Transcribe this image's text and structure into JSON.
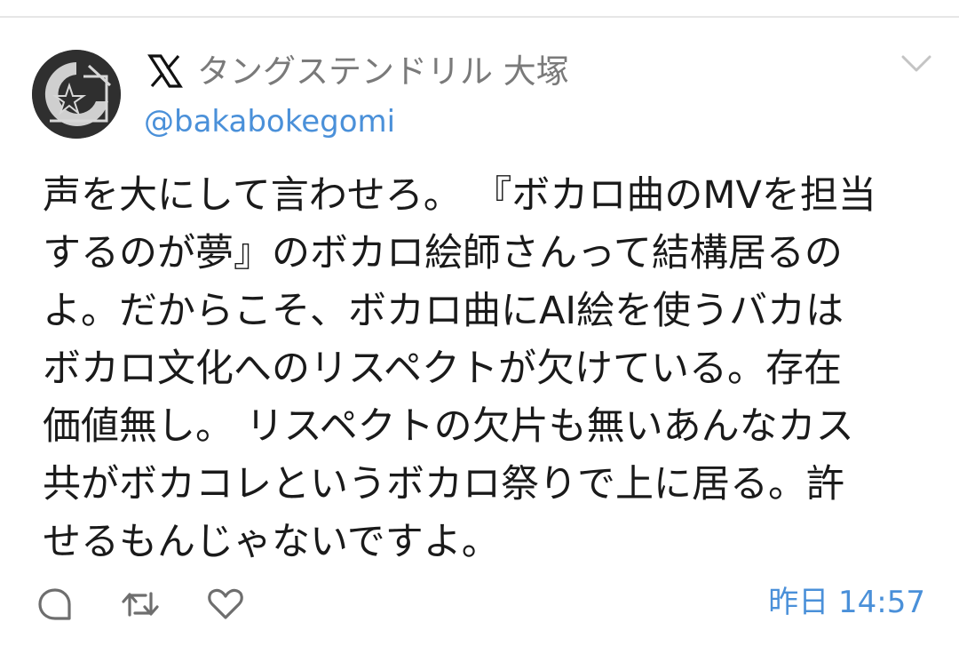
{
  "tweet": {
    "platform_icon": "x-logo-icon",
    "display_name": "タングステンドリル 大塚",
    "handle": "@bakabokegomi",
    "text_lines": [
      "声を大にして言わせろ。 『ボカロ曲のMVを担当",
      "するのが夢』のボカロ絵師さんって結構居るの",
      "よ。だからこそ、ボカロ曲にAI絵を使うバカは",
      "ボカロ文化へのリスペクトが欠けている。存在",
      "価値無し。 リスペクトの欠片も無いあんなカス",
      "共がボカコレというボカロ祭りで上に居る。許",
      "せるもんじゃないですよ。"
    ],
    "timestamp": "昨日 14:57"
  },
  "actions": {
    "reply_icon": "reply-bubble-icon",
    "retweet_icon": "retweet-icon",
    "like_icon": "heart-icon"
  },
  "colors": {
    "link_blue": "#4a90d9",
    "name_gray": "#7a7a7a",
    "icon_gray": "#6e6e6e",
    "text": "#1a1a1a"
  }
}
